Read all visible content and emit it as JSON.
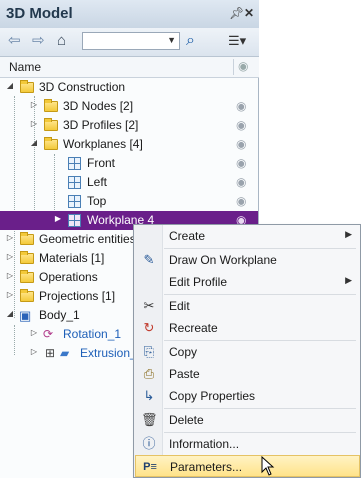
{
  "panel": {
    "title": "3D Model",
    "column_header": "Name",
    "icons": {
      "pin": "pin-icon",
      "close": "close-icon"
    }
  },
  "toolbar": {
    "back_icon": "back-arrow-icon",
    "forward_icon": "forward-arrow-icon",
    "home_icon": "home-icon",
    "combo_value": "",
    "search_icon": "search-icon",
    "view_icon": "list-view-icon"
  },
  "tree": {
    "items": [
      {
        "label": "3D Construction",
        "icon": "folder-icon",
        "expanded": true
      },
      {
        "label": "3D Nodes [2]",
        "icon": "folder-icon",
        "expanded": false
      },
      {
        "label": "3D Profiles [2]",
        "icon": "folder-icon",
        "expanded": false
      },
      {
        "label": "Workplanes [4]",
        "icon": "folder-icon",
        "expanded": true
      },
      {
        "label": "Front",
        "icon": "workplane-icon"
      },
      {
        "label": "Left",
        "icon": "workplane-icon"
      },
      {
        "label": "Top",
        "icon": "workplane-icon"
      },
      {
        "label": "Workplane 4",
        "icon": "workplane-icon",
        "selected": true
      },
      {
        "label": "Geometric entities",
        "icon": "folder-icon",
        "expanded": false
      },
      {
        "label": "Materials [1]",
        "icon": "folder-icon",
        "expanded": false
      },
      {
        "label": "Operations",
        "icon": "folder-icon",
        "expanded": false
      },
      {
        "label": "Projections [1]",
        "icon": "folder-icon",
        "expanded": false
      },
      {
        "label": "Body_1",
        "icon": "body-icon",
        "expanded": true
      },
      {
        "label": "Rotation_1",
        "icon": "rotation-icon"
      },
      {
        "label": "Extrusion_",
        "icon": "extrusion-icon"
      }
    ]
  },
  "context_menu": {
    "items": [
      {
        "label": "Create",
        "icon": "",
        "submenu": true
      },
      {
        "label": "Draw On Workplane",
        "icon": "draw-icon"
      },
      {
        "label": "Edit Profile",
        "icon": "",
        "submenu": true
      },
      {
        "label": "Edit",
        "icon": "scissors-icon"
      },
      {
        "label": "Recreate",
        "icon": "recreate-icon"
      },
      {
        "label": "Copy",
        "icon": "copy-icon"
      },
      {
        "label": "Paste",
        "icon": "paste-icon"
      },
      {
        "label": "Copy Properties",
        "icon": "copy-properties-icon"
      },
      {
        "label": "Delete",
        "icon": "trash-icon"
      },
      {
        "label": "Information...",
        "icon": "info-icon"
      },
      {
        "label": "Parameters...",
        "icon": "parameters-icon",
        "highlighted": true
      }
    ]
  },
  "colors": {
    "selection": "#6a1f8a",
    "menu_highlight": "#ffe38a",
    "link_text": "#1d5fb8"
  }
}
